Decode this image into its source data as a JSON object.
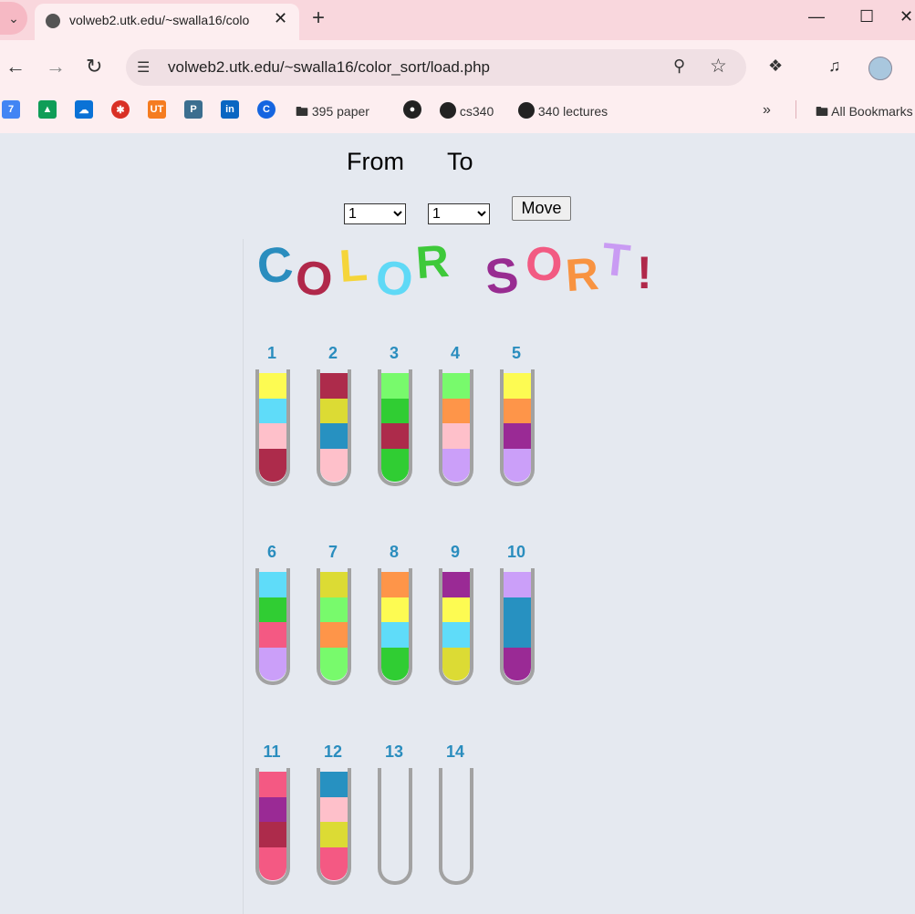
{
  "browser": {
    "tab_title": "volweb2.utk.edu/~swalla16/colo",
    "url": "volweb2.utk.edu/~swalla16/color_sort/load.php",
    "bookmarks": [
      {
        "label": "395 paper"
      },
      {
        "label": "cs340"
      },
      {
        "label": "340 lectures"
      },
      {
        "label": "All Bookmarks"
      }
    ]
  },
  "controls": {
    "from_label": "From",
    "to_label": "To",
    "from_value": "1",
    "to_value": "1",
    "move_label": "Move"
  },
  "logo": {
    "letters": [
      {
        "ch": "C",
        "color": "#2a8dbe"
      },
      {
        "ch": "O",
        "color": "#b0284a"
      },
      {
        "ch": "L",
        "color": "#f5d53a"
      },
      {
        "ch": "O",
        "color": "#5fd9f6"
      },
      {
        "ch": "R",
        "color": "#3ec93a"
      },
      {
        "ch": "S",
        "color": "#982c91"
      },
      {
        "ch": "O",
        "color": "#f25a82"
      },
      {
        "ch": "R",
        "color": "#f89341"
      },
      {
        "ch": "T",
        "color": "#c99bf3"
      },
      {
        "ch": "!",
        "color": "#b0284a"
      }
    ]
  },
  "tubes": [
    {
      "n": "1",
      "colors": [
        "#fdfb52",
        "#5fdcf9",
        "#fec0ca",
        "#ad2b4b"
      ]
    },
    {
      "n": "2",
      "colors": [
        "#ad2b4b",
        "#dcdb34",
        "#2791c1",
        "#fec0ca"
      ]
    },
    {
      "n": "3",
      "colors": [
        "#78fa6c",
        "#30cd33",
        "#ad2b4b",
        "#30cd33"
      ]
    },
    {
      "n": "4",
      "colors": [
        "#78fa6c",
        "#fe9549",
        "#fec0ca",
        "#cb9ff9"
      ]
    },
    {
      "n": "5",
      "colors": [
        "#fdfb52",
        "#fe9549",
        "#9a2a95",
        "#cb9ff9"
      ]
    },
    {
      "n": "6",
      "colors": [
        "#5fdcf9",
        "#30cd33",
        "#f45983",
        "#cb9ff9"
      ]
    },
    {
      "n": "7",
      "colors": [
        "#dcdb34",
        "#78fa6c",
        "#fe9549",
        "#78fa6c"
      ]
    },
    {
      "n": "8",
      "colors": [
        "#fe9549",
        "#fdfb52",
        "#5fdcf9",
        "#30cd33"
      ]
    },
    {
      "n": "9",
      "colors": [
        "#9a2a95",
        "#fdfb52",
        "#5fdcf9",
        "#dcdb34"
      ]
    },
    {
      "n": "10",
      "colors": [
        "#cb9ff9",
        "#2791c1",
        "#2791c1",
        "#9a2a95"
      ]
    },
    {
      "n": "11",
      "colors": [
        "#f45983",
        "#9a2a95",
        "#ad2b4b",
        "#f45983"
      ]
    },
    {
      "n": "12",
      "colors": [
        "#2791c1",
        "#fec0ca",
        "#dcdb34",
        "#f45983"
      ]
    },
    {
      "n": "13",
      "colors": []
    },
    {
      "n": "14",
      "colors": []
    }
  ]
}
